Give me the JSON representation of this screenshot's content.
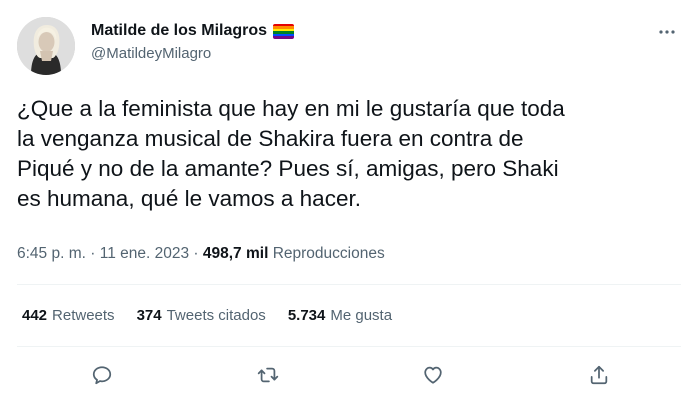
{
  "author": {
    "display_name": "Matilde de los Milagros",
    "handle": "@MatildeyMilagro",
    "avatar_icon": "avatar-photo",
    "badge_icon": "rainbow-flag-icon"
  },
  "tweet": {
    "text_lines": [
      "¿Que a la feminista que hay en mi le gustaría que toda",
      "la venganza musical de Shakira fuera en contra de",
      "Piqué y no de la amante? Pues sí, amigas, pero Shaki",
      "es humana, qué le vamos a hacer."
    ],
    "time": "6:45 p. m.",
    "dot": "·",
    "date": "11 ene. 2023",
    "views_count": "498,7 mil",
    "views_label": "Reproducciones"
  },
  "stats": {
    "retweets_count": "442",
    "retweets_label": "Retweets",
    "quotes_count": "374",
    "quotes_label": "Tweets citados",
    "likes_count": "5.734",
    "likes_label": "Me gusta"
  },
  "actions": {
    "reply_icon": "reply-icon",
    "retweet_icon": "retweet-icon",
    "like_icon": "heart-icon",
    "share_icon": "share-icon",
    "more_icon": "more-icon"
  },
  "colors": {
    "text": "#0f1419",
    "secondary": "#536471",
    "divider": "#eff3f4"
  }
}
